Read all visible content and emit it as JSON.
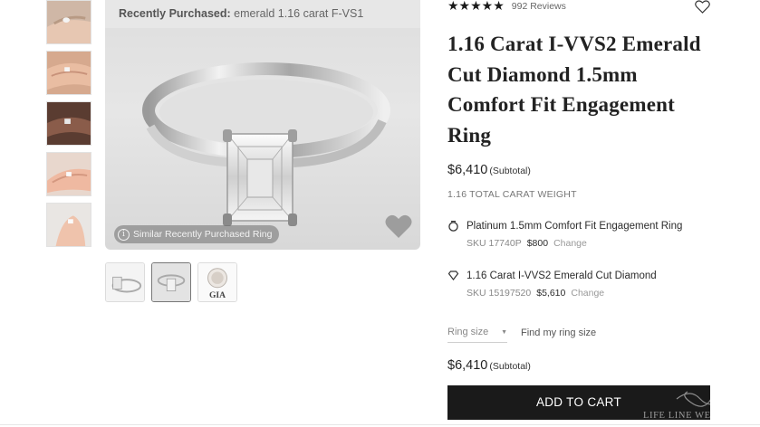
{
  "reviews": {
    "stars": "★★★★★",
    "count": "992 Reviews"
  },
  "banner": {
    "label": "Recently Purchased:",
    "value": "emerald 1.16 carat F-VS1"
  },
  "similar_pill": "Similar Recently Purchased Ring",
  "gia_label": "GIA",
  "title": "1.16 Carat I-VVS2 Emerald Cut Diamond 1.5mm Comfort Fit Engagement Ring",
  "price_top": {
    "amount": "$6,410",
    "label": "(Subtotal)"
  },
  "carat_weight": "1.16 TOTAL CARAT WEIGHT",
  "items": [
    {
      "name": "Platinum 1.5mm Comfort Fit Engagement Ring",
      "sku": "SKU 17740P",
      "price": "$800",
      "change": "Change",
      "icon": "ring-icon"
    },
    {
      "name": "1.16 Carat I-VVS2 Emerald Cut Diamond",
      "sku": "SKU 15197520",
      "price": "$5,610",
      "change": "Change",
      "icon": "diamond-icon"
    }
  ],
  "ring_size": {
    "placeholder": "Ring size"
  },
  "find_ring_size": "Find my ring size",
  "price_bottom": {
    "amount": "$6,410",
    "label": "(Subtotal)"
  },
  "add_to_cart": "ADD TO CART",
  "watermark": "LIFE LINE WEDDING",
  "colors": {
    "button": "#1a1a1a",
    "image_bg": "#e0e0e0",
    "text": "#222222"
  }
}
